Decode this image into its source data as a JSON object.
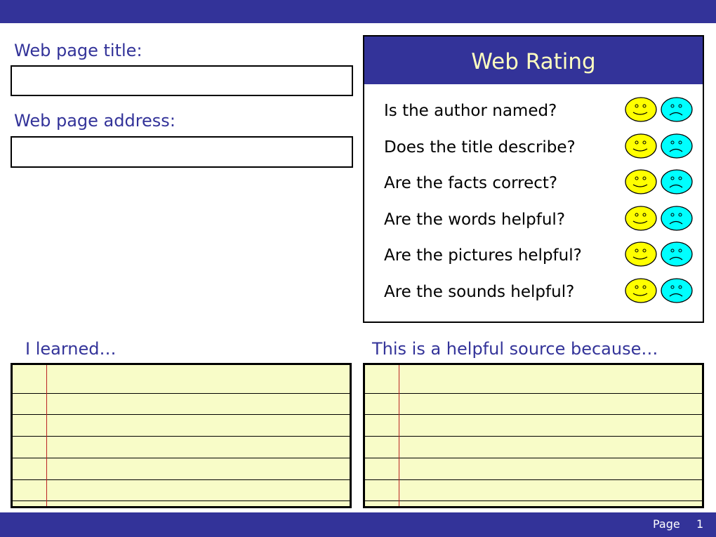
{
  "labels": {
    "title": "Web page title:",
    "address": "Web page address:",
    "learned": "I learned…",
    "helpful": "This is a helpful source because…"
  },
  "fields": {
    "title": "",
    "address": ""
  },
  "rating": {
    "heading": "Web Rating",
    "questions": [
      "Is the author named?",
      "Does the title describe?",
      "Are the facts correct?",
      "Are the words helpful?",
      "Are the pictures helpful?",
      "Are the sounds helpful?"
    ]
  },
  "footer": {
    "page_label": "Page",
    "page_number": "1"
  },
  "colors": {
    "brand": "#333399",
    "happy": "#ffff00",
    "sad": "#00ffff",
    "pad": "#f8fcc8"
  }
}
